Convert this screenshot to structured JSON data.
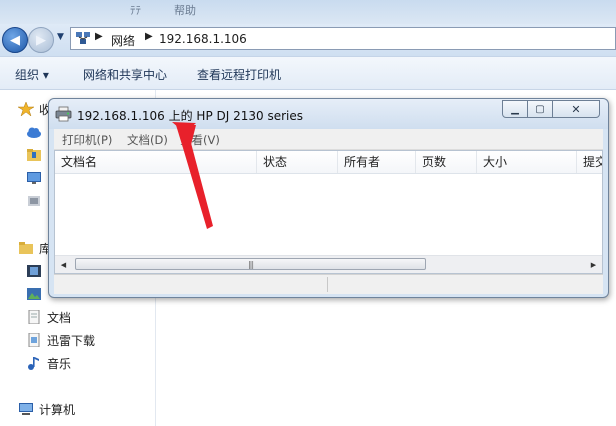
{
  "explorer": {
    "top_ghost": [
      "ﾃﾃ",
      "帮助"
    ],
    "address": {
      "icon": "network-icon",
      "items": [
        "网络",
        "192.168.1.106"
      ]
    },
    "toolbar": {
      "organize": "组织",
      "network_center": "网络和共享中心",
      "view_remote_printers": "查看远程打印机"
    },
    "nav": {
      "favorites_partial": "收",
      "libraries_partial": "库",
      "documents": "文档",
      "xunlei": "迅雷下载",
      "music": "音乐",
      "computer": "计算机"
    }
  },
  "queue_window": {
    "title": "192.168.1.106 上的 HP DJ 2130 series",
    "menu": [
      "打印机(P)",
      "文档(D)",
      "查看(V)"
    ],
    "columns": [
      "文档名",
      "状态",
      "所有者",
      "页数",
      "大小",
      "提交"
    ],
    "rows": []
  },
  "colors": {
    "annotation_arrow": "#e8212b",
    "title_bar": "#d6e4f3",
    "nav_bar": "#cfdff1"
  }
}
